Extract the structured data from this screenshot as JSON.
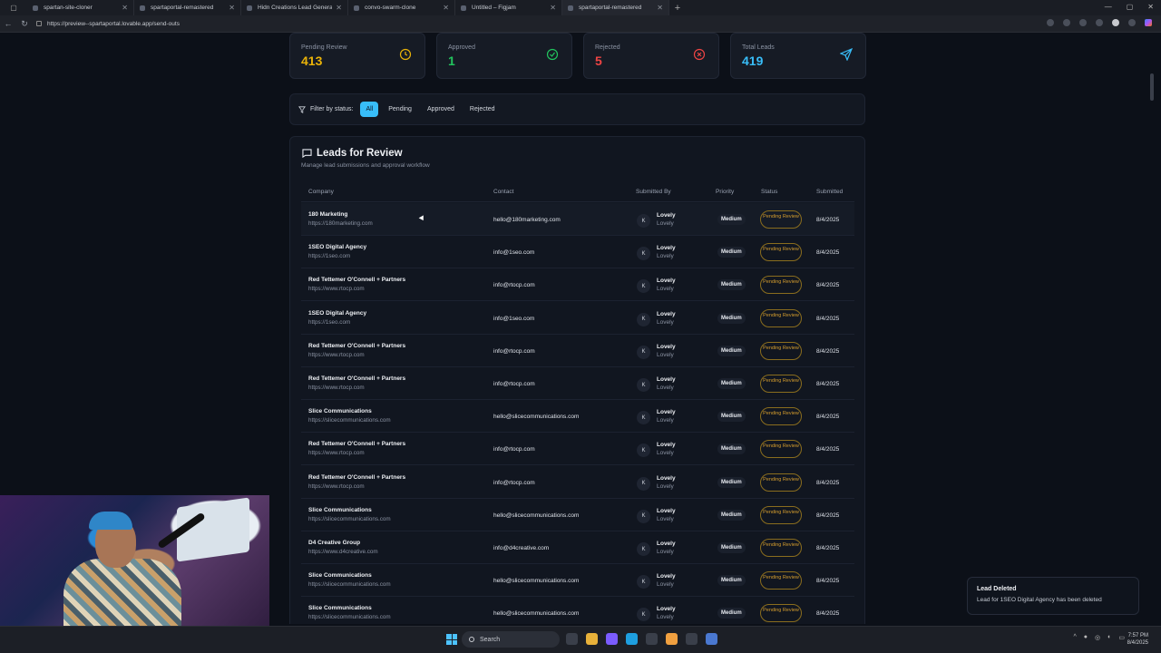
{
  "browser": {
    "tabs": [
      {
        "title": "spartan-site-cloner",
        "active": false
      },
      {
        "title": "spartaportal-remastered",
        "active": false
      },
      {
        "title": "Hidn Creations Lead Generator -",
        "active": false
      },
      {
        "title": "convo-swarm-clone",
        "active": false
      },
      {
        "title": "Untitled – Figjam",
        "active": false
      },
      {
        "title": "spartaportal-remastered",
        "active": true
      }
    ],
    "new_tab": "+",
    "url": "https://preview--spartaportal.lovable.app/send-outs"
  },
  "stats": [
    {
      "label": "Pending Review",
      "value": "413",
      "color": "#eab308",
      "icon": "clock-icon"
    },
    {
      "label": "Approved",
      "value": "1",
      "color": "#22c55e",
      "icon": "check-circle-icon"
    },
    {
      "label": "Rejected",
      "value": "5",
      "color": "#ef4444",
      "icon": "x-circle-icon"
    },
    {
      "label": "Total Leads",
      "value": "419",
      "color": "#38bdf8",
      "icon": "send-icon"
    }
  ],
  "filter": {
    "label": "Filter by status:",
    "options": [
      "All",
      "Pending",
      "Approved",
      "Rejected"
    ],
    "selected": "All"
  },
  "leads": {
    "title": "Leads for Review",
    "subtitle": "Manage lead submissions and approval workflow",
    "columns": [
      "Company",
      "Contact",
      "Submitted By",
      "Priority",
      "Status",
      "Submitted"
    ],
    "rows": [
      {
        "company": "180 Marketing",
        "url": "https://180marketing.com",
        "contact": "hello@180marketing.com",
        "avatar": "K",
        "by": "Lovely",
        "by2": "Lovely",
        "priority": "Medium",
        "status": "Pending Review",
        "date": "8/4/2025"
      },
      {
        "company": "1SEO Digital Agency",
        "url": "https://1seo.com",
        "contact": "info@1seo.com",
        "avatar": "K",
        "by": "Lovely",
        "by2": "Lovely",
        "priority": "Medium",
        "status": "Pending Review",
        "date": "8/4/2025"
      },
      {
        "company": "Red Tettemer O'Connell + Partners",
        "url": "https://www.rtocp.com",
        "contact": "info@rtocp.com",
        "avatar": "K",
        "by": "Lovely",
        "by2": "Lovely",
        "priority": "Medium",
        "status": "Pending Review",
        "date": "8/4/2025"
      },
      {
        "company": "1SEO Digital Agency",
        "url": "https://1seo.com",
        "contact": "info@1seo.com",
        "avatar": "K",
        "by": "Lovely",
        "by2": "Lovely",
        "priority": "Medium",
        "status": "Pending Review",
        "date": "8/4/2025"
      },
      {
        "company": "Red Tettemer O'Connell + Partners",
        "url": "https://www.rtocp.com",
        "contact": "info@rtocp.com",
        "avatar": "K",
        "by": "Lovely",
        "by2": "Lovely",
        "priority": "Medium",
        "status": "Pending Review",
        "date": "8/4/2025"
      },
      {
        "company": "Red Tettemer O'Connell + Partners",
        "url": "https://www.rtocp.com",
        "contact": "info@rtocp.com",
        "avatar": "K",
        "by": "Lovely",
        "by2": "Lovely",
        "priority": "Medium",
        "status": "Pending Review",
        "date": "8/4/2025"
      },
      {
        "company": "Slice Communications",
        "url": "https://slicecommunications.com",
        "contact": "hello@slicecommunications.com",
        "avatar": "K",
        "by": "Lovely",
        "by2": "Lovely",
        "priority": "Medium",
        "status": "Pending Review",
        "date": "8/4/2025"
      },
      {
        "company": "Red Tettemer O'Connell + Partners",
        "url": "https://www.rtocp.com",
        "contact": "info@rtocp.com",
        "avatar": "K",
        "by": "Lovely",
        "by2": "Lovely",
        "priority": "Medium",
        "status": "Pending Review",
        "date": "8/4/2025"
      },
      {
        "company": "Red Tettemer O'Connell + Partners",
        "url": "https://www.rtocp.com",
        "contact": "info@rtocp.com",
        "avatar": "K",
        "by": "Lovely",
        "by2": "Lovely",
        "priority": "Medium",
        "status": "Pending Review",
        "date": "8/4/2025"
      },
      {
        "company": "Slice Communications",
        "url": "https://slicecommunications.com",
        "contact": "hello@slicecommunications.com",
        "avatar": "K",
        "by": "Lovely",
        "by2": "Lovely",
        "priority": "Medium",
        "status": "Pending Review",
        "date": "8/4/2025"
      },
      {
        "company": "D4 Creative Group",
        "url": "https://www.d4creative.com",
        "contact": "info@d4creative.com",
        "avatar": "K",
        "by": "Lovely",
        "by2": "Lovely",
        "priority": "Medium",
        "status": "Pending Review",
        "date": "8/4/2025"
      },
      {
        "company": "Slice Communications",
        "url": "https://slicecommunications.com",
        "contact": "hello@slicecommunications.com",
        "avatar": "K",
        "by": "Lovely",
        "by2": "Lovely",
        "priority": "Medium",
        "status": "Pending Review",
        "date": "8/4/2025"
      },
      {
        "company": "Slice Communications",
        "url": "https://slicecommunications.com",
        "contact": "hello@slicecommunications.com",
        "avatar": "K",
        "by": "Lovely",
        "by2": "Lovely",
        "priority": "Medium",
        "status": "Pending Review",
        "date": "8/4/2025"
      }
    ]
  },
  "toast": {
    "title": "Lead Deleted",
    "message": "Lead for 1SEO Digital Agency has been deleted"
  },
  "taskbar": {
    "search_placeholder": "Search",
    "time": "7:57 PM",
    "date": "8/4/2025"
  }
}
